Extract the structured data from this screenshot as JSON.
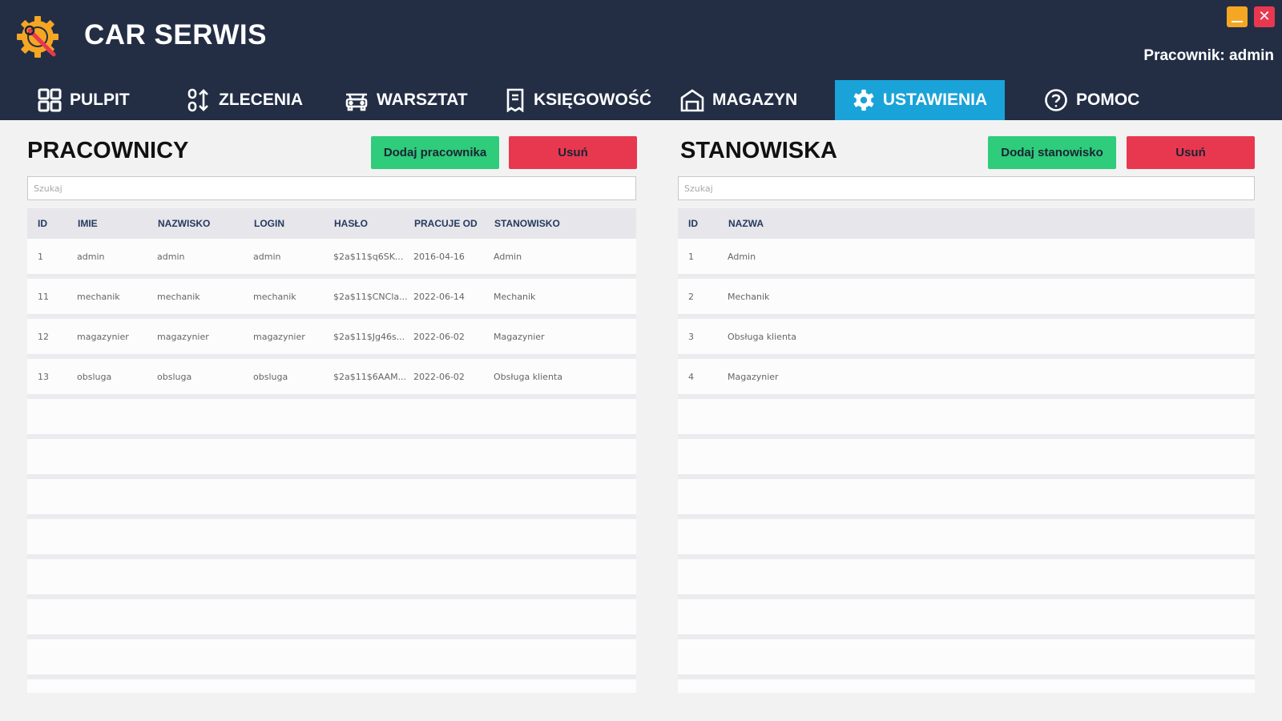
{
  "app": {
    "title": "CAR SERWIS",
    "user_line": "Pracownik: admin",
    "close_glyph": "✕"
  },
  "colors": {
    "header_bg": "#232e45",
    "active_tab": "#1aa3d8",
    "green": "#2ecc7b",
    "red": "#e8384f"
  },
  "nav": [
    {
      "label": "PULPIT",
      "icon": "grid-icon"
    },
    {
      "label": "ZLECENIA",
      "icon": "sort-icon"
    },
    {
      "label": "WARSZTAT",
      "icon": "car-icon"
    },
    {
      "label": "KSIĘGOWOŚĆ",
      "icon": "receipt-icon"
    },
    {
      "label": "MAGAZYN",
      "icon": "warehouse-icon"
    },
    {
      "label": "USTAWIENIA",
      "icon": "gear-icon",
      "active": true
    },
    {
      "label": "POMOC",
      "icon": "help-icon"
    }
  ],
  "employees": {
    "title": "PRACOWNICY",
    "add_label": "Dodaj pracownika",
    "delete_label": "Usuń",
    "search_placeholder": "Szukaj",
    "columns": [
      "ID",
      "IMIE",
      "NAZWISKO",
      "LOGIN",
      "HASŁO",
      "PRACUJE OD",
      "STANOWISKO"
    ],
    "rows": [
      [
        "1",
        "admin",
        "admin",
        "admin",
        "$2a$11$q6SK...",
        "2016-04-16",
        "Admin"
      ],
      [
        "11",
        "mechanik",
        "mechanik",
        "mechanik",
        "$2a$11$CNCla...",
        "2022-06-14",
        "Mechanik"
      ],
      [
        "12",
        "magazynier",
        "magazynier",
        "magazynier",
        "$2a$11$Jg46s...",
        "2022-06-02",
        "Magazynier"
      ],
      [
        "13",
        "obsluga",
        "obsluga",
        "obsluga",
        "$2a$11$6AAM...",
        "2022-06-02",
        "Obsługa klienta"
      ]
    ]
  },
  "positions": {
    "title": "STANOWISKA",
    "add_label": "Dodaj stanowisko",
    "delete_label": "Usuń",
    "search_placeholder": "Szukaj",
    "columns": [
      "ID",
      "NAZWA"
    ],
    "rows": [
      [
        "1",
        "Admin"
      ],
      [
        "2",
        "Mechanik"
      ],
      [
        "3",
        "Obsługa klienta"
      ],
      [
        "4",
        "Magazynier"
      ]
    ]
  }
}
